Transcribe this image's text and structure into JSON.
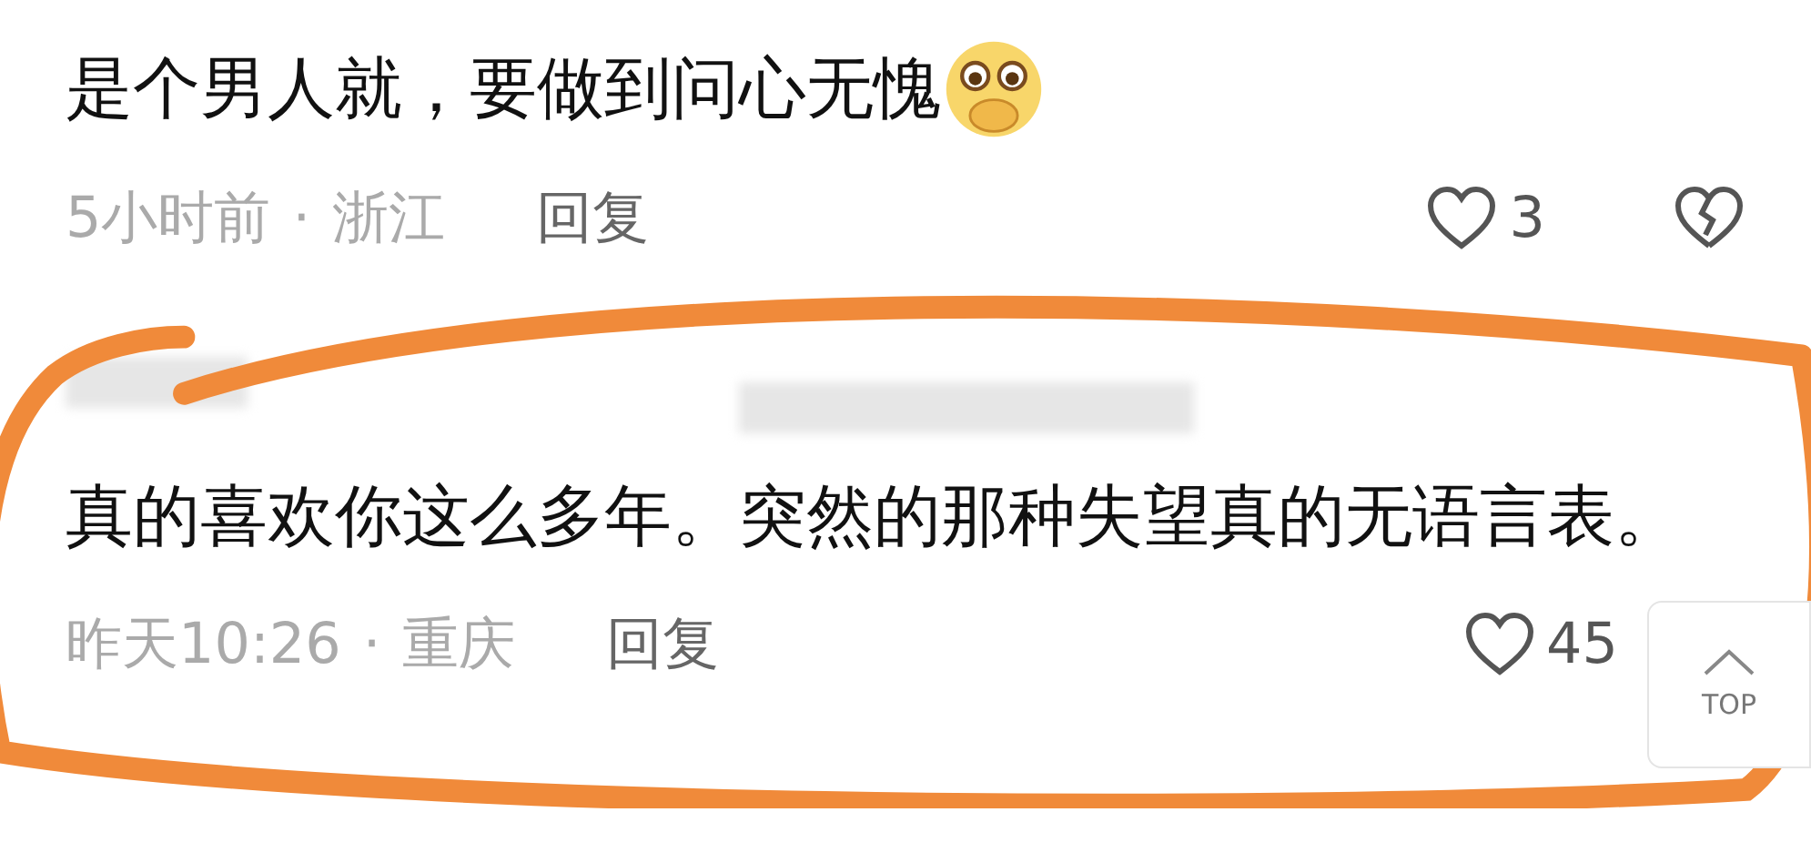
{
  "comments": [
    {
      "text": "是个男人就，要做到问心无愧",
      "emoji": true,
      "time": "5小时前",
      "separator": "·",
      "location": "浙江",
      "reply": "回复",
      "likes": "3",
      "dislike_visible": true,
      "highlighted": false,
      "blurred_header": false
    },
    {
      "text": "真的喜欢你这么多年。突然的那种失望真的无语言表。",
      "emoji": false,
      "time": "昨天10:26",
      "separator": "·",
      "location": "重庆",
      "reply": "回复",
      "likes": "45",
      "dislike_visible": false,
      "highlighted": true,
      "blurred_header": true
    }
  ],
  "top_button": {
    "label": "TOP"
  }
}
